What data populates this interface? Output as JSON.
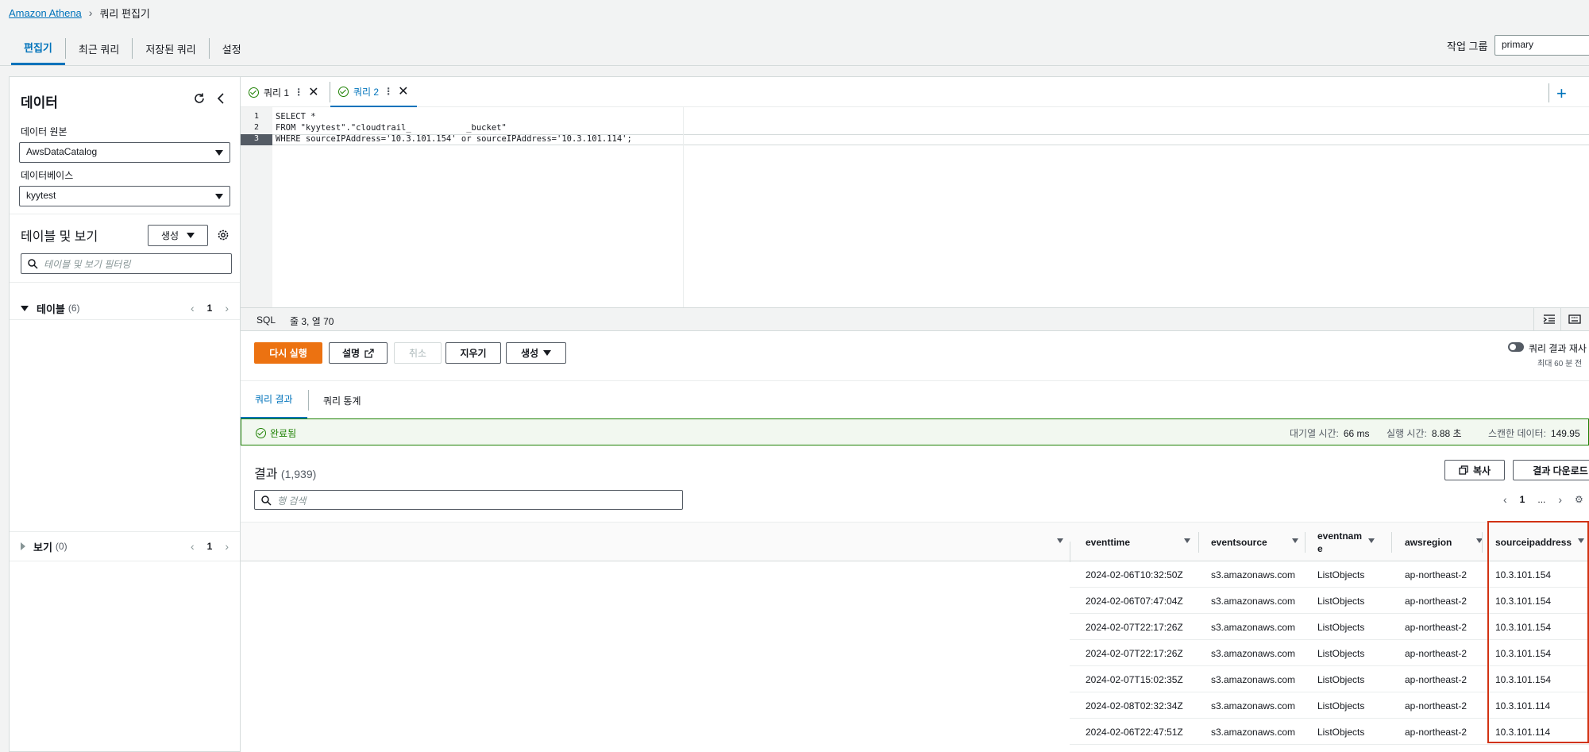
{
  "breadcrumb": {
    "root": "Amazon Athena",
    "current": "쿼리 편집기"
  },
  "top_tabs": [
    "편집기",
    "최근 쿼리",
    "저장된 쿼리",
    "설정"
  ],
  "workgroup": {
    "label": "작업 그룹",
    "value": "primary"
  },
  "data_panel": {
    "title": "데이터",
    "data_source_label": "데이터 원본",
    "data_source_value": "AwsDataCatalog",
    "database_label": "데이터베이스",
    "database_value": "kyytest",
    "tables_heading": "테이블 및 보기",
    "create_label": "생성",
    "filter_placeholder": "테이블 및 보기 필터링",
    "tables_label": "테이블",
    "tables_count": "(6)",
    "tables_page": "1",
    "views_label": "보기",
    "views_count": "(0)",
    "views_page": "1"
  },
  "query_tabs": [
    {
      "label": "쿼리 1",
      "active": false
    },
    {
      "label": "쿼리 2",
      "active": true
    }
  ],
  "editor": {
    "lines": [
      {
        "num": "1",
        "text": "SELECT *"
      },
      {
        "num": "2",
        "text": "FROM \"kyytest\".\"cloudtrail_           _bucket\""
      },
      {
        "num": "3",
        "text": "WHERE sourceIPAddress='10.3.101.154' or sourceIPAddress='10.3.101.114';"
      }
    ],
    "language": "SQL",
    "cursor": "줄 3, 열 70"
  },
  "actions": {
    "run_again": "다시 실행",
    "explain": "설명",
    "cancel": "취소",
    "clear": "지우기",
    "create": "생성",
    "reuse_label": "쿼리 결과 재사",
    "reuse_sub": "최대 60 분 전 "
  },
  "result_tabs": [
    "쿼리 결과",
    "쿼리 통계"
  ],
  "status": {
    "state": "완료됨",
    "queue_label": "대기열 시간:",
    "queue_value": "66 ms",
    "run_label": "실행 시간:",
    "run_value": "8.88 초",
    "scanned_label": "스캔한 데이터:",
    "scanned_value": "149.95 "
  },
  "results": {
    "title": "결과",
    "count": "(1,939)",
    "copy_label": "복사",
    "download_label": "결과 다운로드",
    "search_placeholder": "행 검색",
    "page": "1",
    "ellipsis": "...",
    "columns": [
      "eventtime",
      "eventsource",
      "eventnam\ne",
      "awsregion",
      "sourceipaddress"
    ],
    "rows": [
      [
        "2024-02-06T10:32:50Z",
        "s3.amazonaws.com",
        "ListObjects",
        "ap-northeast-2",
        "10.3.101.154"
      ],
      [
        "2024-02-06T07:47:04Z",
        "s3.amazonaws.com",
        "ListObjects",
        "ap-northeast-2",
        "10.3.101.154"
      ],
      [
        "2024-02-07T22:17:26Z",
        "s3.amazonaws.com",
        "ListObjects",
        "ap-northeast-2",
        "10.3.101.154"
      ],
      [
        "2024-02-07T22:17:26Z",
        "s3.amazonaws.com",
        "ListObjects",
        "ap-northeast-2",
        "10.3.101.154"
      ],
      [
        "2024-02-07T15:02:35Z",
        "s3.amazonaws.com",
        "ListObjects",
        "ap-northeast-2",
        "10.3.101.154"
      ],
      [
        "2024-02-08T02:32:34Z",
        "s3.amazonaws.com",
        "ListObjects",
        "ap-northeast-2",
        "10.3.101.114"
      ],
      [
        "2024-02-06T22:47:51Z",
        "s3.amazonaws.com",
        "ListObjects",
        "ap-northeast-2",
        "10.3.101.114"
      ]
    ]
  },
  "colors": {
    "accent": "#0073bb",
    "primary_button": "#ec7211",
    "success": "#1d8102",
    "highlight": "#d13212"
  }
}
